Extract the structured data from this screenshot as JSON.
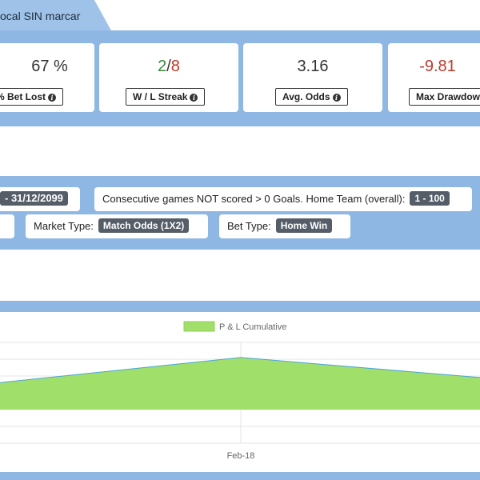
{
  "header": {
    "tab_title": "ocal SIN marcar"
  },
  "stats": [
    {
      "value": "67 %",
      "label": "% Bet Lost"
    },
    {
      "value_win": "2",
      "value_sep": "/",
      "value_loss": "8",
      "label": "W / L Streak"
    },
    {
      "value": "3.16",
      "label": "Avg. Odds"
    },
    {
      "value": "-9.81",
      "label": "Max Drawdow"
    }
  ],
  "filters": {
    "date_range": "- 31/12/2099",
    "consecutive_label": "Consecutive games NOT scored > 0 Goals. Home Team (overall):",
    "consecutive_value": "1 - 100",
    "market_label": "Market Type:",
    "market_value": "Match Odds (1X2)",
    "bet_label": "Bet Type:",
    "bet_value": "Home Win"
  },
  "chart_data": {
    "type": "area",
    "legend": "P & L Cumulative",
    "legend_position": "top-center",
    "x_tick_labels": [
      "Feb-18"
    ],
    "x_index": [
      0,
      1,
      2
    ],
    "values": [
      1.6,
      3.1,
      1.9
    ],
    "ylim": [
      -2,
      4
    ],
    "grid": true,
    "colors": {
      "fill": "#a0e06a",
      "line": "#4aa3d8"
    }
  },
  "colors": {
    "panel": "#8fb7e4",
    "tab": "#9fc3e8",
    "win": "#3a8a3a",
    "loss": "#c0392b"
  }
}
